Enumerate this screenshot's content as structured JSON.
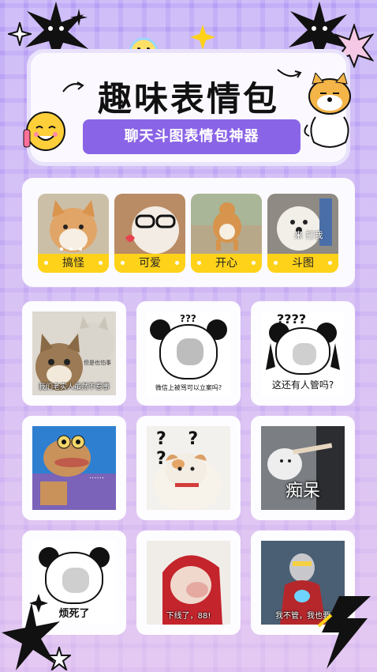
{
  "header": {
    "title": "趣味表情包",
    "subtitle": "聊天斗图表情包神器"
  },
  "categories": [
    {
      "label": "搞怪"
    },
    {
      "label": "可爱"
    },
    {
      "label": "开心"
    },
    {
      "label": "斗图"
    }
  ],
  "category_photo_texts": {
    "fight_caption": "来 打我"
  },
  "memes": [
    {
      "caption": "我们老实人虽然不惹事",
      "secondary": "但是也怕事"
    },
    {
      "caption": "微信上被骂可以立案吗?",
      "marks": "???"
    },
    {
      "caption": "这还有人管吗?",
      "marks": "????"
    },
    {
      "caption": "......"
    },
    {
      "caption": "",
      "marks": "? ? ?"
    },
    {
      "caption": "痴呆"
    },
    {
      "caption": "烦死了"
    },
    {
      "caption": "下线了，88!"
    },
    {
      "caption": "我不管，我也要"
    }
  ],
  "colors": {
    "accent_purple": "#8a64e6",
    "label_yellow": "#ffd21a",
    "background": "#b79ff5"
  }
}
